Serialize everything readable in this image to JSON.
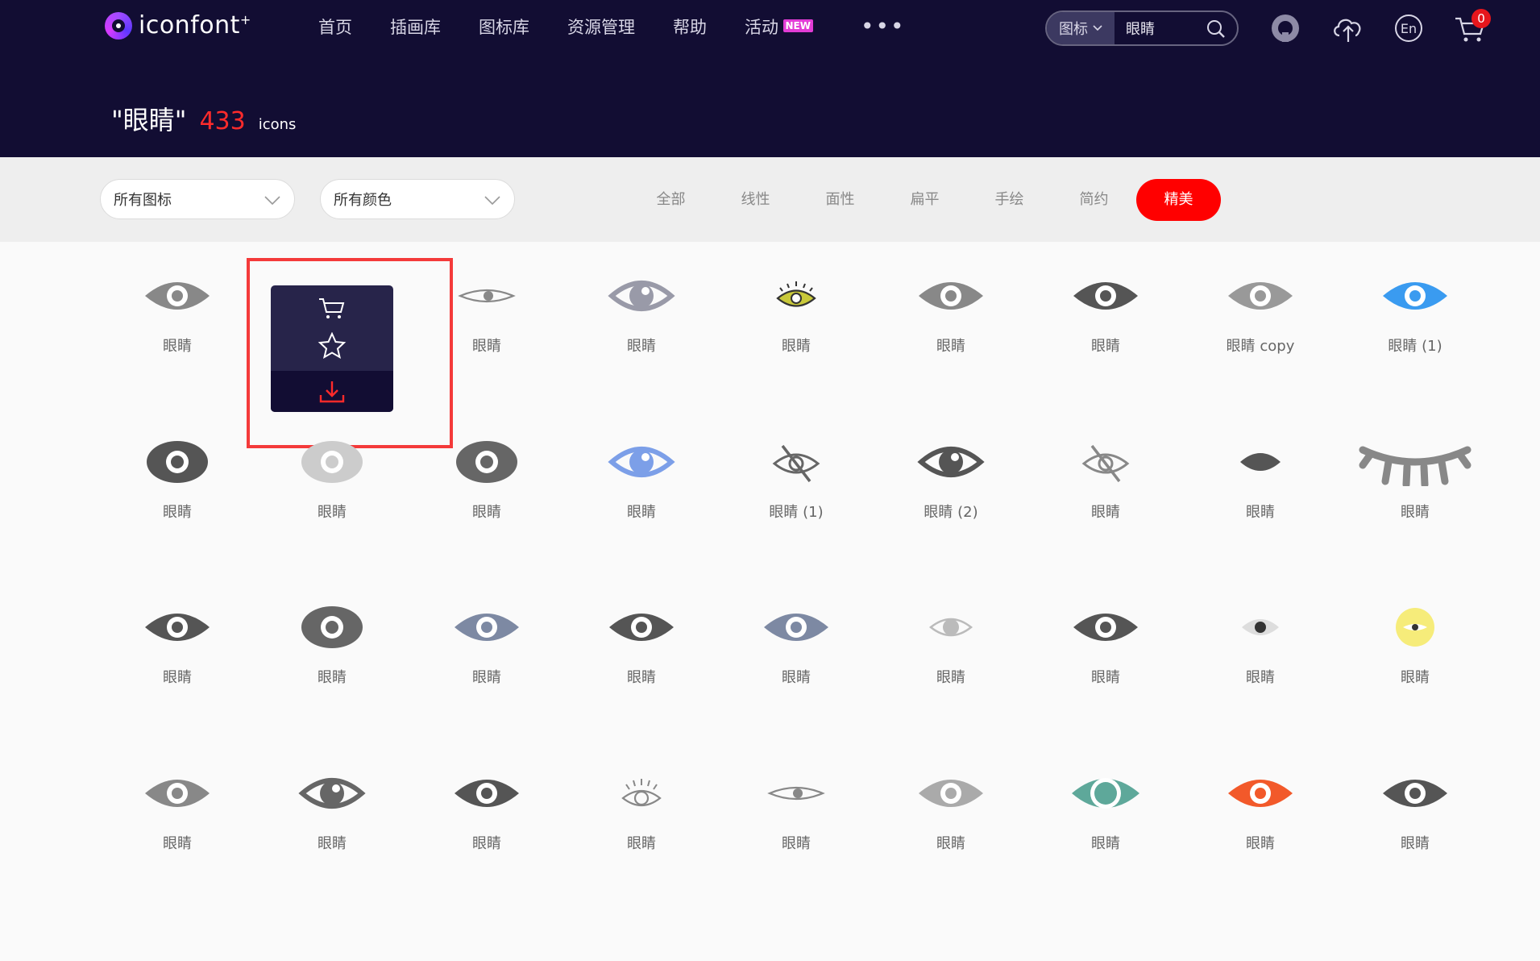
{
  "logo": {
    "text": "iconfont",
    "mark": "+"
  },
  "nav": [
    "首页",
    "插画库",
    "图标库",
    "资源管理",
    "帮助",
    "活动"
  ],
  "nav_badge": "NEW",
  "nav_more": "•••",
  "search": {
    "type": "图标",
    "value": "眼睛"
  },
  "cart_count": "0",
  "page_title": {
    "query": "\"眼睛\"",
    "count": "433",
    "unit": "icons"
  },
  "filters": {
    "icon_type": "所有图标",
    "color": "所有颜色"
  },
  "style_tabs": [
    "全部",
    "线性",
    "面性",
    "扁平",
    "手绘",
    "简约",
    "精美"
  ],
  "active_style": "精美",
  "icons": [
    {
      "label": "眼睛",
      "style": "eye-filled",
      "color": "#888888"
    },
    {
      "label": "",
      "style": "hover",
      "color": "#888888"
    },
    {
      "label": "眼睛",
      "style": "eye-thin",
      "color": "#888888"
    },
    {
      "label": "眼睛",
      "style": "eye-outline-big",
      "color": "#999aa8"
    },
    {
      "label": "眼睛",
      "style": "eye-yellow",
      "color": "#c9c93a"
    },
    {
      "label": "眼睛",
      "style": "eye-filled",
      "color": "#888888"
    },
    {
      "label": "眼睛",
      "style": "eye-filled",
      "color": "#555555"
    },
    {
      "label": "眼睛 copy",
      "style": "eye-filled",
      "color": "#999999"
    },
    {
      "label": "眼睛 (1)",
      "style": "eye-filled",
      "color": "#3a9bf0"
    },
    {
      "label": "眼睛",
      "style": "eye-round",
      "color": "#555555"
    },
    {
      "label": "眼睛",
      "style": "eye-round",
      "color": "#cccccc"
    },
    {
      "label": "眼睛",
      "style": "eye-round",
      "color": "#666666"
    },
    {
      "label": "眼睛",
      "style": "eye-outline-big",
      "color": "#7c9fe8"
    },
    {
      "label": "眼睛 (1)",
      "style": "eye-slash",
      "color": "#666666"
    },
    {
      "label": "眼睛 (2)",
      "style": "eye-outline-big",
      "color": "#555555"
    },
    {
      "label": "眼睛",
      "style": "eye-slash",
      "color": "#888888"
    },
    {
      "label": "眼睛",
      "style": "eye-shape",
      "color": "#555555"
    },
    {
      "label": "眼睛",
      "style": "eye-closed",
      "color": "#888888"
    },
    {
      "label": "眼睛",
      "style": "eye-filled",
      "color": "#555555"
    },
    {
      "label": "眼睛",
      "style": "eye-round",
      "color": "#666666"
    },
    {
      "label": "眼睛",
      "style": "eye-filled",
      "color": "#7d89a3"
    },
    {
      "label": "眼睛",
      "style": "eye-filled",
      "color": "#555555"
    },
    {
      "label": "眼睛",
      "style": "eye-filled",
      "color": "#7d89a3"
    },
    {
      "label": "眼睛",
      "style": "eye-light",
      "color": "#bbbbbb"
    },
    {
      "label": "眼睛",
      "style": "eye-filled",
      "color": "#555555"
    },
    {
      "label": "眼睛",
      "style": "eye-dot",
      "color": "#dddddd"
    },
    {
      "label": "眼睛",
      "style": "eye-circle",
      "color": "#f6ec7a"
    },
    {
      "label": "眼睛",
      "style": "eye-filled",
      "color": "#888888"
    },
    {
      "label": "眼睛",
      "style": "eye-outline-big",
      "color": "#666666"
    },
    {
      "label": "眼睛",
      "style": "eye-filled",
      "color": "#555555"
    },
    {
      "label": "眼睛",
      "style": "eye-lash",
      "color": "#888888"
    },
    {
      "label": "眼睛",
      "style": "eye-thin",
      "color": "#888888"
    },
    {
      "label": "眼睛",
      "style": "eye-filled",
      "color": "#aaaaaa"
    },
    {
      "label": "眼睛",
      "style": "eye-teal",
      "color": "#5ea89a"
    },
    {
      "label": "眼睛",
      "style": "eye-filled",
      "color": "#f2592a"
    },
    {
      "label": "眼睛",
      "style": "eye-filled",
      "color": "#555555"
    }
  ]
}
